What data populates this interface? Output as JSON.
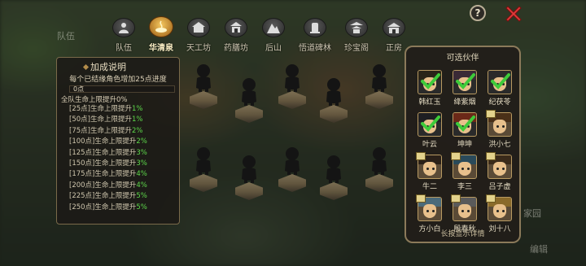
{
  "tabs": [
    {
      "label": "队伍",
      "icon": "team-icon",
      "active": false
    },
    {
      "label": "华清泉",
      "icon": "spring-icon",
      "active": true
    },
    {
      "label": "天工坊",
      "icon": "workshop-icon",
      "active": false
    },
    {
      "label": "药膳坊",
      "icon": "kitchen-icon",
      "active": false
    },
    {
      "label": "后山",
      "icon": "mountain-icon",
      "active": false
    },
    {
      "label": "悟道碑林",
      "icon": "stele-icon",
      "active": false
    },
    {
      "label": "珍宝阁",
      "icon": "pavilion-icon",
      "active": false
    },
    {
      "label": "正房",
      "icon": "house-icon",
      "active": false
    }
  ],
  "help_label": "?",
  "bonus": {
    "title": "加成说明",
    "description": "每个已结缘角色增加25点进度",
    "progress_text": "0点",
    "progress_fraction": 0.0,
    "total_line": "全队生命上限提升0%",
    "tiers": [
      {
        "prefix": "[25点]生命上限提升",
        "value": "1%"
      },
      {
        "prefix": "[50点]生命上限提升",
        "value": "1%"
      },
      {
        "prefix": "[75点]生命上限提升",
        "value": "2%"
      },
      {
        "prefix": "[100点]生命上限提升",
        "value": "2%"
      },
      {
        "prefix": "[125点]生命上限提升",
        "value": "3%"
      },
      {
        "prefix": "[150点]生命上限提升",
        "value": "3%"
      },
      {
        "prefix": "[175点]生命上限提升",
        "value": "4%"
      },
      {
        "prefix": "[200点]生命上限提升",
        "value": "4%"
      },
      {
        "prefix": "[225点]生命上限提升",
        "value": "5%"
      },
      {
        "prefix": "[250点]生命上限提升",
        "value": "5%"
      }
    ]
  },
  "companions": {
    "title": "可选伙伴",
    "hint": "长按显示详情",
    "items": [
      {
        "name": "韩红玉",
        "checked": true,
        "hair": "#2a2418"
      },
      {
        "name": "绛紫烟",
        "checked": true,
        "hair": "#3a2a36"
      },
      {
        "name": "纪茯苓",
        "checked": true,
        "hair": "#2c2a2a"
      },
      {
        "name": "叶云",
        "checked": true,
        "hair": "#1e1e22"
      },
      {
        "name": "坤坤",
        "checked": true,
        "hair": "#6a2818"
      },
      {
        "name": "洪小七",
        "checked": false,
        "hair": "#4a3018"
      },
      {
        "name": "牛二",
        "checked": false,
        "hair": "#2a2018"
      },
      {
        "name": "李三",
        "checked": false,
        "hair": "#2a4a5a"
      },
      {
        "name": "吕子虚",
        "checked": false,
        "hair": "#3a2a1a"
      },
      {
        "name": "方小白",
        "checked": false,
        "hair": "#4a6a7a"
      },
      {
        "name": "殷春秋",
        "checked": false,
        "hair": "#5a5a5a"
      },
      {
        "name": "刘十八",
        "checked": false,
        "hair": "#8a6a2a"
      }
    ]
  },
  "background": {
    "left_ghost": "队伍",
    "right_ghost_1": "家园",
    "right_ghost_2": "编辑"
  },
  "colors": {
    "accent": "#c49a4a",
    "bonus_value": "#5dd84a",
    "check": "#3ecb3a",
    "close": "#e03a3a"
  }
}
